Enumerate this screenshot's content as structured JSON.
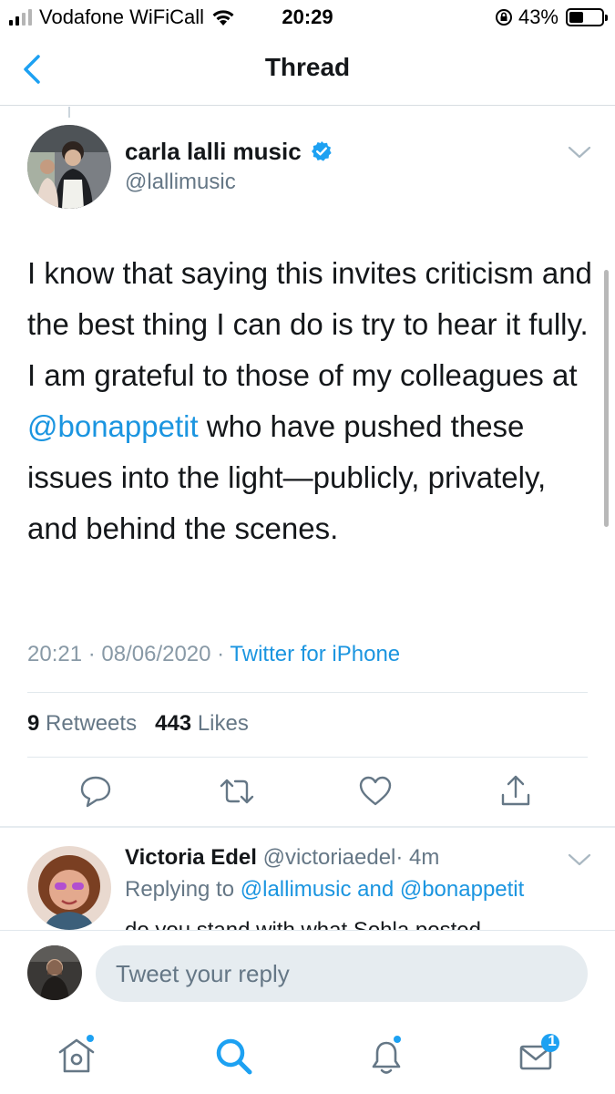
{
  "status_bar": {
    "carrier": "Vodafone WiFiCall",
    "time": "20:29",
    "battery_percent": "43%",
    "battery_level": 0.43,
    "icons": [
      "signal-icon",
      "wifi-icon",
      "orientation-lock-icon",
      "battery-icon"
    ]
  },
  "nav": {
    "title": "Thread",
    "back_icon": "chevron-left-icon"
  },
  "tweet": {
    "author_name": "carla lalli music",
    "author_handle": "@lallimusic",
    "verified": true,
    "text_before_mention": "I know that saying this invites criticism and the best thing I can do is try to hear it fully. I am grateful to those of my colleagues at ",
    "mention": "@bonappetit",
    "text_after_mention": " who have pushed these issues into the light—publicly, privately, and behind the scenes.",
    "timestamp": "20:21 · 08/06/2020 · ",
    "source": "Twitter for iPhone",
    "retweets_count": "9",
    "retweets_label": "Retweets",
    "likes_count": "443",
    "likes_label": "Likes",
    "action_icons": [
      "reply-icon",
      "retweet-icon",
      "like-icon",
      "share-icon"
    ]
  },
  "reply": {
    "author_name": "Victoria Edel",
    "author_handle": "@victoriaedel",
    "time_ago": "· 4m",
    "replying_prefix": "Replying to ",
    "replying_mentions": "@lallimusic and @bonappetit",
    "text_preview": "do you stand with what Sohla posted"
  },
  "composer": {
    "placeholder": "Tweet your reply"
  },
  "tab_bar": {
    "tabs": [
      {
        "icon": "home-icon",
        "dot": true
      },
      {
        "icon": "search-icon",
        "active": true
      },
      {
        "icon": "notifications-icon",
        "dot": true
      },
      {
        "icon": "messages-icon",
        "badge": "1"
      }
    ]
  },
  "colors": {
    "accent": "#1da1f2",
    "link": "#1b95e0",
    "text": "#14171a",
    "secondary_text": "#657786"
  }
}
